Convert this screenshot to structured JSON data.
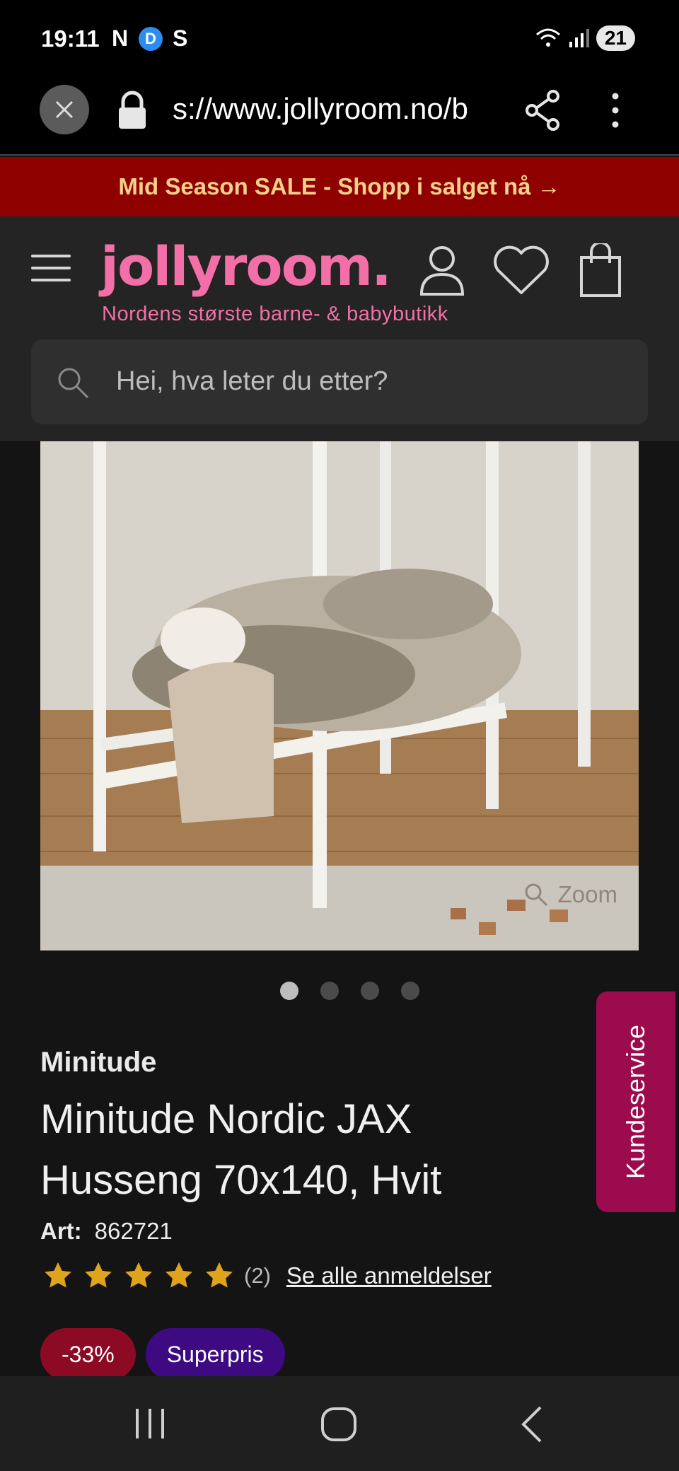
{
  "status_bar": {
    "time": "19:11",
    "apps": [
      "N",
      "D",
      "S"
    ],
    "battery": "21"
  },
  "browser": {
    "url": "s://www.jollyroom.no/b",
    "icons": [
      "close-icon",
      "lock-icon",
      "share-icon",
      "more-vert-icon"
    ]
  },
  "sale_banner": {
    "text": "Mid Season SALE - Shopp i salget nå →"
  },
  "header": {
    "logo": "jollyroom.",
    "tagline": "Nordens største barne- & babybutikk",
    "search_placeholder": "Hei, hva leter du etter?"
  },
  "gallery": {
    "zoom_label": "Zoom",
    "dots_count": 4,
    "active_dot": 0
  },
  "product": {
    "brand": "Minitude",
    "title": "Minitude Nordic JAX Husseng 70x140, Hvit",
    "art_label": "Art:",
    "art_number": "862721",
    "rating": 5,
    "review_count": "(2)",
    "reviews_link": "Se alle anmeldelser",
    "badges": {
      "discount": "-33%",
      "super": "Superpris"
    }
  },
  "customer_service": {
    "label": "Kundeservice"
  },
  "colors": {
    "brand_pink": "#f36fa7",
    "sale_red": "#8f0000",
    "star": "#e0a31c",
    "kundeservice": "#9c0b4e"
  }
}
